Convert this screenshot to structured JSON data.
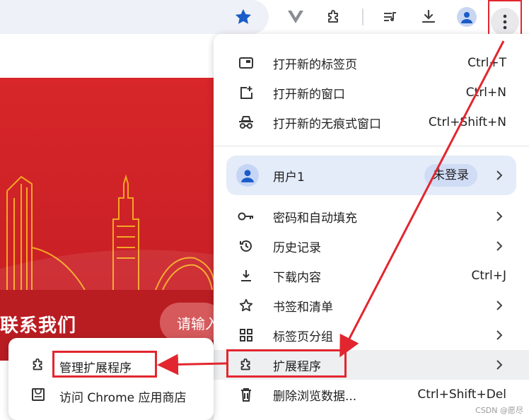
{
  "colors": {
    "accent": "#1a73e8",
    "annotation_red": "#e2262f",
    "banner_red": "#d8262a",
    "menu_bg": "#ffffff",
    "profile_bg": "#e4ecf9"
  },
  "toolbar": {
    "bookmark_icon": "star-icon",
    "icons": [
      "vivaldi-icon",
      "extensions-icon",
      "media-icon",
      "download-icon",
      "profile-icon",
      "more-vert-icon"
    ]
  },
  "page": {
    "contact_text": "联系我们",
    "search_text": "请输入"
  },
  "menu": {
    "items_top": [
      {
        "label": "打开新的标签页",
        "shortcut": "Ctrl+T",
        "icon": "new-tab-icon"
      },
      {
        "label": "打开新的窗口",
        "shortcut": "Ctrl+N",
        "icon": "new-window-icon"
      },
      {
        "label": "打开新的无痕式窗口",
        "shortcut": "Ctrl+Shift+N",
        "icon": "incognito-icon"
      }
    ],
    "profile": {
      "name": "用户1",
      "status": "未登录"
    },
    "items_bottom": [
      {
        "label": "密码和自动填充",
        "shortcut": "",
        "icon": "key-icon",
        "submenu": true
      },
      {
        "label": "历史记录",
        "shortcut": "",
        "icon": "history-icon",
        "submenu": true
      },
      {
        "label": "下载内容",
        "shortcut": "Ctrl+J",
        "icon": "download-icon",
        "submenu": false
      },
      {
        "label": "书签和清单",
        "shortcut": "",
        "icon": "star-outline-icon",
        "submenu": true
      },
      {
        "label": "标签页分组",
        "shortcut": "",
        "icon": "grid-icon",
        "submenu": true
      },
      {
        "label": "扩展程序",
        "shortcut": "",
        "icon": "puzzle-icon",
        "submenu": true
      },
      {
        "label": "删除浏览数据...",
        "shortcut": "Ctrl+Shift+Del",
        "icon": "trash-icon",
        "submenu": false
      }
    ]
  },
  "submenu": {
    "items": [
      {
        "label": "管理扩展程序",
        "icon": "puzzle-icon"
      },
      {
        "label": "访问 Chrome 应用商店",
        "icon": "store-icon"
      }
    ]
  },
  "watermark": "CSDN @愿尽"
}
